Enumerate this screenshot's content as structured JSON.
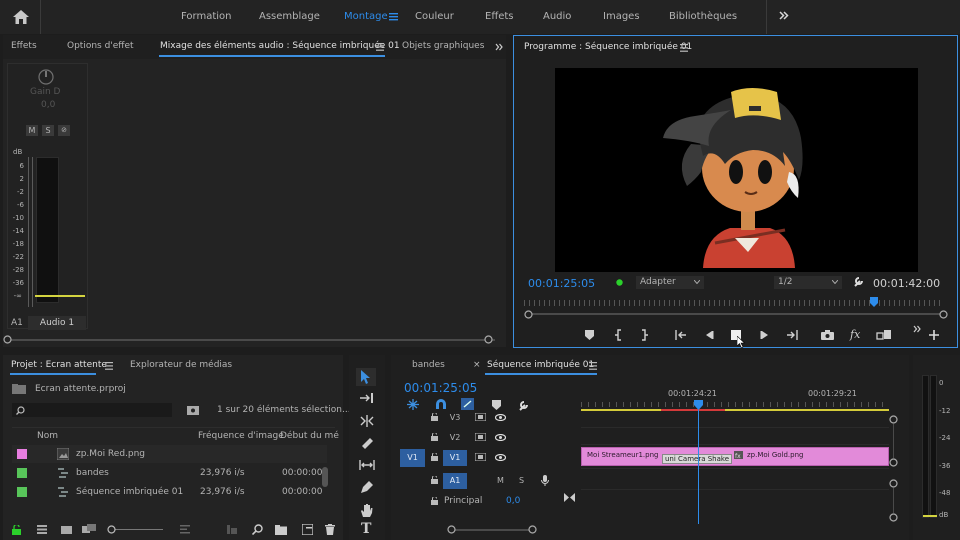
{
  "topnav": {
    "items": [
      "Formation",
      "Assemblage",
      "Montage",
      "Couleur",
      "Effets",
      "Audio",
      "Images",
      "Bibliothèques"
    ],
    "active_index": 2
  },
  "left_panel": {
    "tabs": [
      "Effets",
      "Options d'effet",
      "Mixage des éléments audio : Séquence imbriquée 01",
      "Objets graphiques"
    ],
    "active_index": 2
  },
  "mixer": {
    "gain_label": "Gain D",
    "gain_value": "0,0",
    "buttons": [
      "M",
      "S",
      "⊘"
    ],
    "db_label": "dB",
    "db_scale": [
      "6",
      "2",
      "-2",
      "-6",
      "-10",
      "-14",
      "-18",
      "-22",
      "-28",
      "-36",
      "-∞"
    ],
    "track_id": "A1",
    "track_name": "Audio 1"
  },
  "program": {
    "title": "Programme : Séquence imbriquée 01",
    "timecode": "00:01:25:05",
    "fit": "Adapter",
    "resolution": "1/2",
    "duration": "00:01:42:00"
  },
  "project": {
    "tabs": [
      "Projet : Ecran attente",
      "Explorateur de médias"
    ],
    "file": "Ecran attente.prproj",
    "count": "1 sur 20 éléments sélection...",
    "columns": [
      "Nom",
      "Fréquence d'image",
      "Début du mé"
    ],
    "rows": [
      {
        "name": "zp.Moi Red.png",
        "fps": "",
        "start": "",
        "color": "#e87ee0"
      },
      {
        "name": "bandes",
        "fps": "23,976 i/s",
        "start": "00:00:00",
        "color": "#58c55a"
      },
      {
        "name": "Séquence imbriquée 01",
        "fps": "23,976 i/s",
        "start": "00:00:00",
        "color": "#58c55a"
      }
    ]
  },
  "timeline": {
    "tabs": [
      "bandes",
      "Séquence imbriquée 01"
    ],
    "timecode": "00:01:25:05",
    "ruler": [
      "00:01:24:21",
      "00:01:29:21"
    ],
    "tracks": [
      {
        "name": "V3"
      },
      {
        "name": "V2"
      },
      {
        "name": "V1",
        "source": "V1"
      },
      {
        "name": "A1",
        "buttons": [
          "M",
          "S"
        ]
      }
    ],
    "principal_label": "Principal",
    "principal_value": "0,0",
    "clips": [
      {
        "name": "Moi Streameur1.png"
      },
      {
        "name": "uni Camera Shake"
      },
      {
        "name": "zp.Moi Gold.png"
      }
    ]
  },
  "meter": {
    "scale": [
      "0",
      "-12",
      "-24",
      "-36",
      "-48",
      "dB"
    ]
  },
  "colors": {
    "accent": "#2d8ceb",
    "clip_pink": "#e28ad9",
    "label_green": "#58c55a",
    "panel_bg": "#232323"
  }
}
